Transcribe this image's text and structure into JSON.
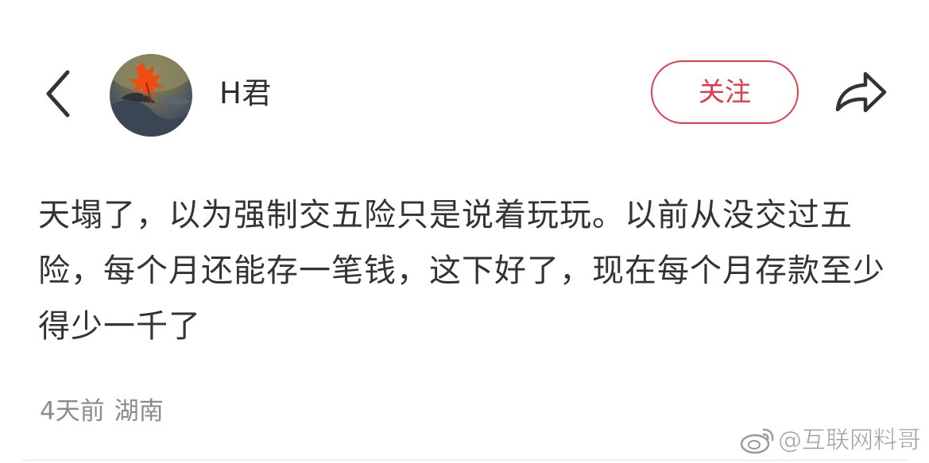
{
  "header": {
    "back_icon": "chevron-left-icon",
    "avatar_icon": "maple-leaf-avatar",
    "username": "H君",
    "follow_label": "关注",
    "share_icon": "share-arrow-icon"
  },
  "post": {
    "content": "天塌了，以为强制交五险只是说着玩玩。以前从没交过五险，每个月还能存一笔钱，这下好了，现在每个月存款至少得少一千了",
    "time": "4天前",
    "location": "湖南"
  },
  "watermark": {
    "text": "@互联网料哥",
    "icon": "weibo-logo-icon"
  },
  "colors": {
    "accent": "#e13a4c",
    "text": "#333333",
    "meta": "#8c8c8c"
  }
}
